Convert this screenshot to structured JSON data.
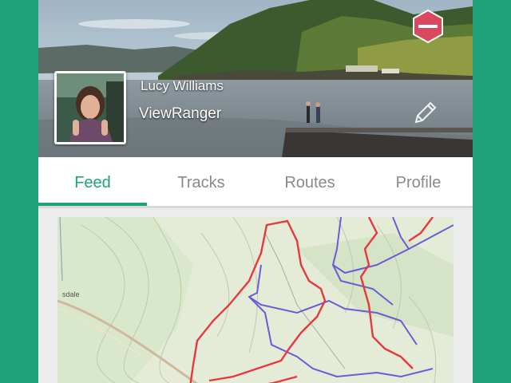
{
  "profile": {
    "user_name": "Lucy Williams",
    "org_name": "ViewRanger"
  },
  "tabs": [
    {
      "label": "Feed",
      "active": true
    },
    {
      "label": "Tracks",
      "active": false
    },
    {
      "label": "Routes",
      "active": false
    },
    {
      "label": "Profile",
      "active": false
    }
  ],
  "map": {
    "place_label": "sdale"
  },
  "colors": {
    "accent": "#1fa27a",
    "track_red": "#e8383d",
    "track_purple": "#6b5bd6"
  },
  "icons": {
    "edit": "pencil-icon",
    "badge": "hexagon-badge-icon"
  }
}
